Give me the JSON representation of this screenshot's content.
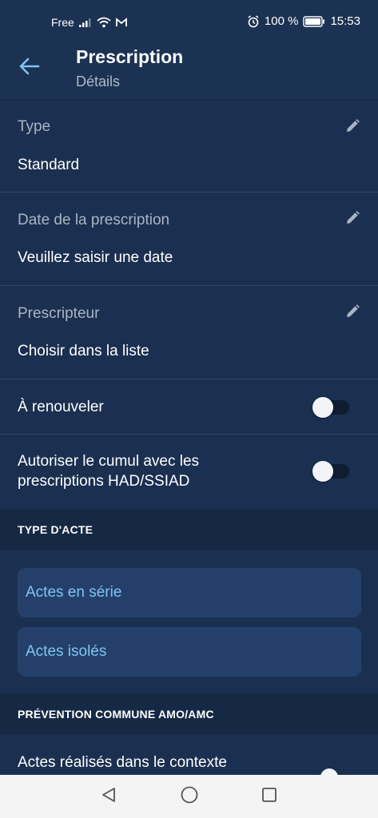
{
  "statusbar": {
    "carrier": "Free",
    "battery": "100 %",
    "time": "15:53"
  },
  "appbar": {
    "title": "Prescription",
    "subtitle": "Détails"
  },
  "fields": [
    {
      "label": "Type",
      "value": "Standard"
    },
    {
      "label": "Date de la prescription",
      "value": "Veuillez saisir une date"
    },
    {
      "label": "Prescripteur",
      "value": "Choisir dans la liste"
    }
  ],
  "toggles": [
    {
      "label": "À renouveler",
      "on": false
    },
    {
      "label_line1": "Autoriser le cumul avec les",
      "label_line2": "prescriptions HAD/SSIAD",
      "on": false
    }
  ],
  "sections": {
    "type_acte": "TYPE D'ACTE",
    "prevention": "PRÉVENTION COMMUNE AMO/AMC"
  },
  "acte_options": [
    "Actes en série",
    "Actes isolés"
  ],
  "partial_row": "Actes réalisés dans le contexte",
  "colors": {
    "background": "#1b3050",
    "accent": "#7fc4f1",
    "section": "#162944",
    "card": "#24406a"
  },
  "icons": {
    "back": "arrow-left-icon",
    "edit": "pencil-icon",
    "nav_back": "triangle-back-icon",
    "nav_home": "circle-home-icon",
    "nav_recent": "square-recent-icon"
  }
}
